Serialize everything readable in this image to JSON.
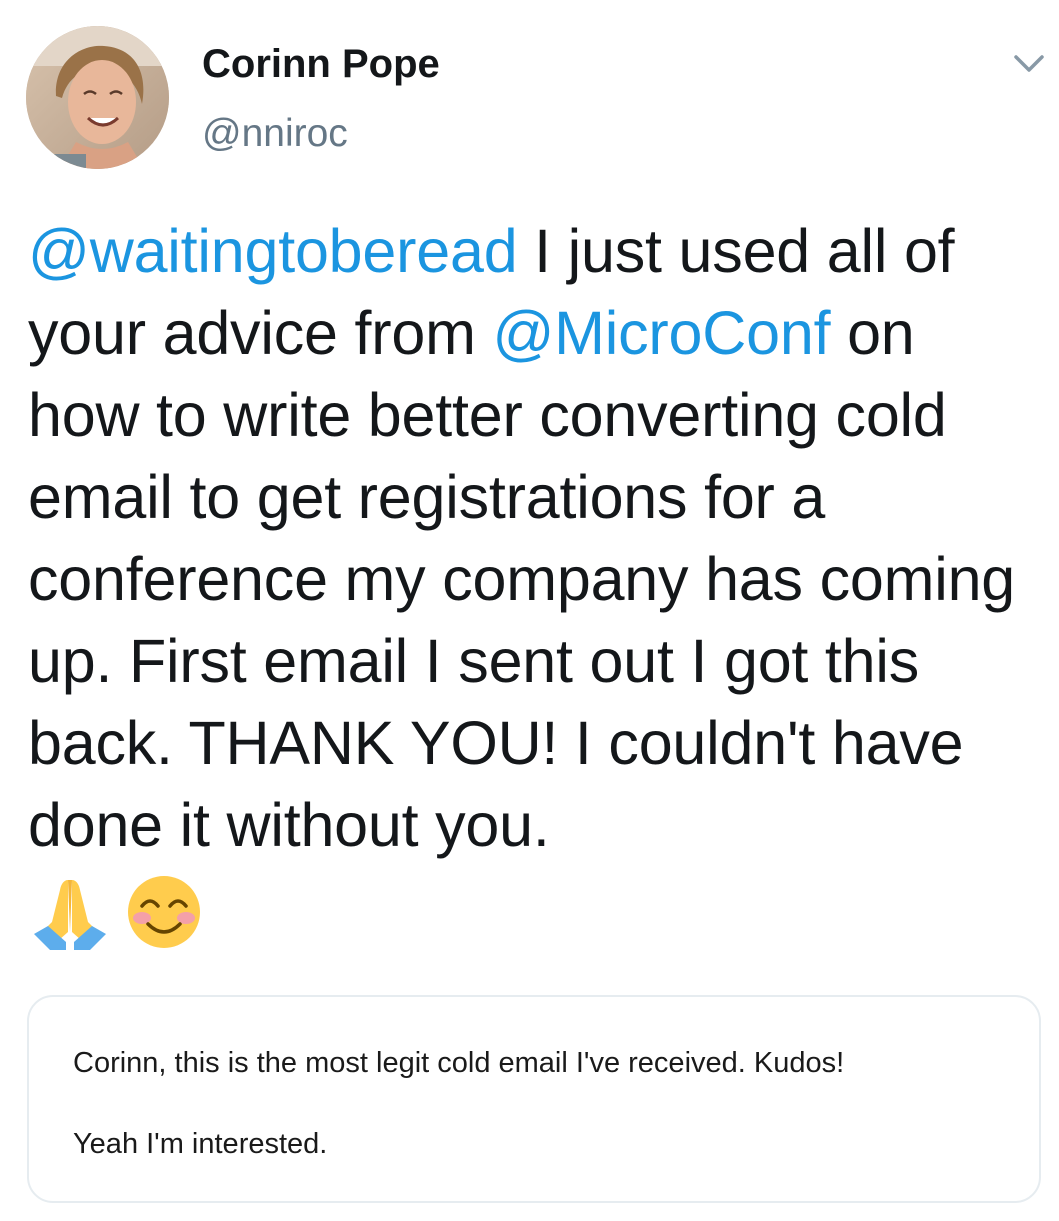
{
  "tweet": {
    "author": {
      "name": "Corinn Pope",
      "handle": "@nniroc",
      "avatar_icon": "profile-photo"
    },
    "menu_icon": "chevron-down-icon",
    "text_segments": [
      {
        "type": "mention",
        "text": "@waitingtoberead"
      },
      {
        "type": "text",
        "text": " I just used all of your advice from "
      },
      {
        "type": "mention",
        "text": "@MicroConf"
      },
      {
        "type": "text",
        "text": " on how to write better converting cold email to get registrations for a conference my company has coming up. First email I sent out I got this back. THANK YOU! I couldn't have done it without you."
      }
    ],
    "emojis": [
      "folded-hands-emoji",
      "smiling-face-with-smiling-eyes-emoji"
    ],
    "attached_image": {
      "line1": "Corinn, this is the most legit cold email I've received. Kudos!",
      "line2": "Yeah I'm interested."
    }
  },
  "colors": {
    "mention": "#1b95e0",
    "text": "#14171a",
    "handle": "#657786",
    "card_border": "#e6ecf0"
  }
}
